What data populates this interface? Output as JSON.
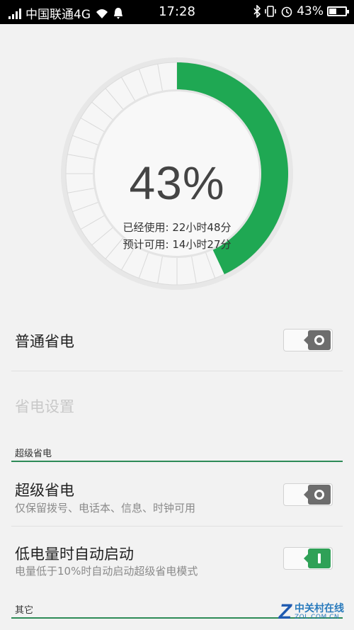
{
  "status_bar": {
    "carrier": "中国联通4G",
    "time": "17:28",
    "battery_text": "43%",
    "battery_level": 0.43
  },
  "gauge": {
    "percent_text": "43%",
    "level": 0.43,
    "used_label": "已经使用:",
    "used_value": "22小时48分",
    "remain_label": "预计可用:",
    "remain_value": "14小时27分",
    "accent_color": "#1fa853"
  },
  "normal_saving": {
    "title": "普通省电",
    "toggle_on": false
  },
  "saving_settings": {
    "title": "省电设置"
  },
  "super_section": {
    "header": "超级省电"
  },
  "super_saving": {
    "title": "超级省电",
    "subtitle": "仅保留拨号、电话本、信息、时钟可用",
    "toggle_on": false
  },
  "low_battery_auto": {
    "title": "低电量时自动启动",
    "subtitle": "电量低于10%时自动启动超级省电模式",
    "toggle_on": true
  },
  "other_section": {
    "header": "其它"
  },
  "watermark": {
    "logo_letter": "Z",
    "name": "中关村在线",
    "domain": "ZOL.COM.CN"
  }
}
